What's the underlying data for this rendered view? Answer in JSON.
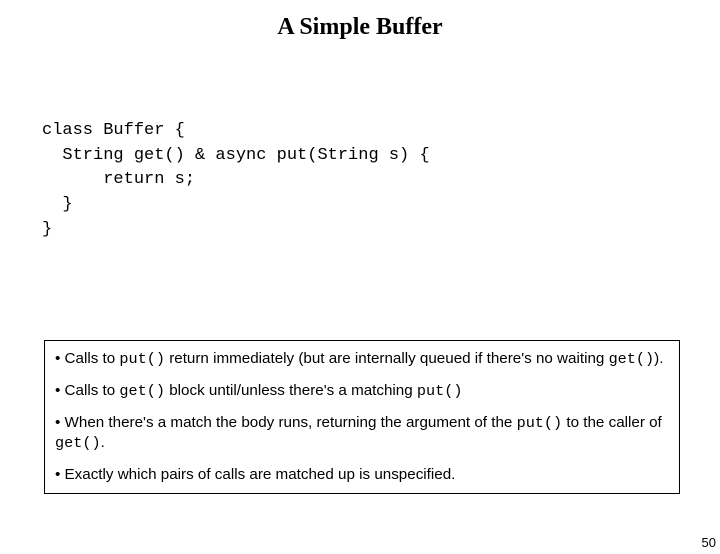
{
  "title": "A Simple Buffer",
  "code": {
    "l1": "class Buffer {",
    "l2": "  String get() & async put(String s) {",
    "l3": "      return s;",
    "l4": "  }",
    "l5": "}"
  },
  "bullets": {
    "b1_a": "• Calls to ",
    "b1_code1": "put()",
    "b1_b": " return immediately (but are internally queued if there's no waiting ",
    "b1_code2": "get()",
    "b1_c": ").",
    "b2_a": "• Calls to ",
    "b2_code1": "get()",
    "b2_b": " block until/unless there's a matching ",
    "b2_code2": "put()",
    "b3_a": "• When there's a match the body runs, returning the argument of the ",
    "b3_code1": "put()",
    "b3_b": " to the caller of ",
    "b3_code2": "get()",
    "b3_c": ".",
    "b4": "• Exactly which pairs of calls are matched up is unspecified."
  },
  "page_number": "50"
}
